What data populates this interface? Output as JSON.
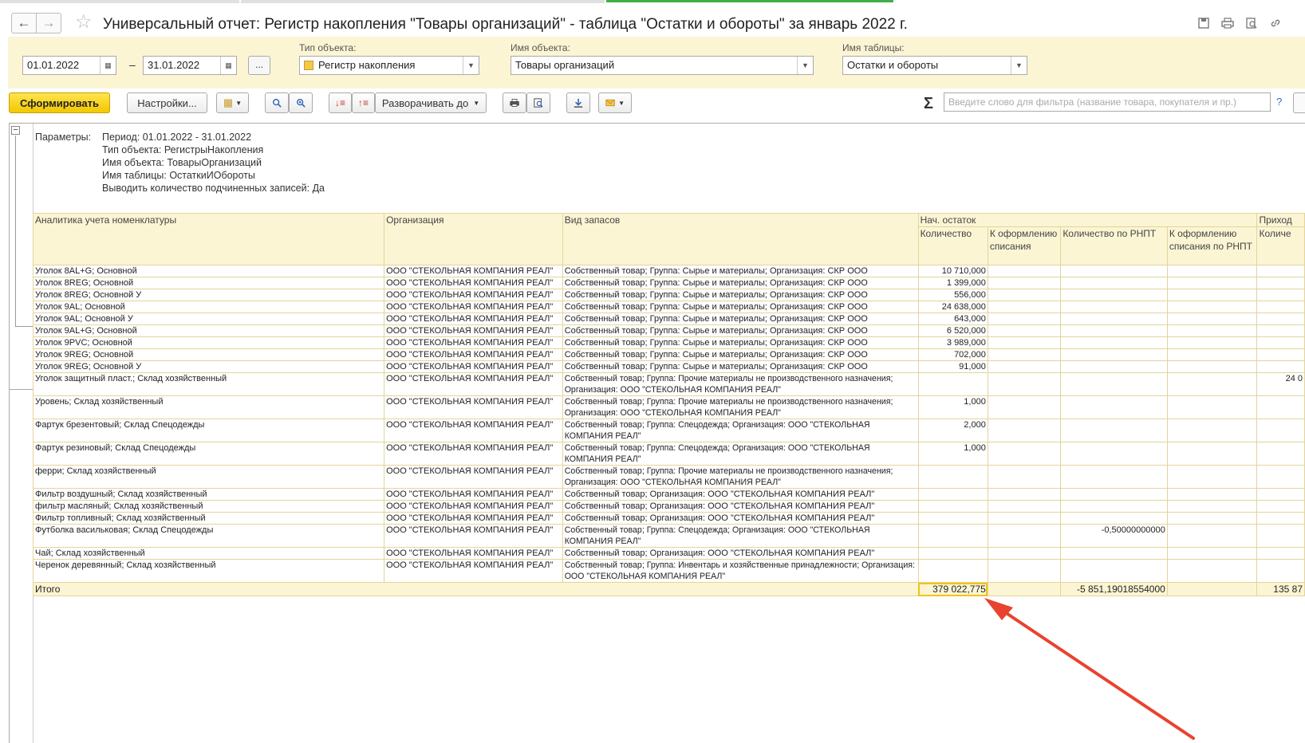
{
  "window": {
    "title": "Универсальный отчет: Регистр накопления \"Товары организаций\" - таблица \"Остатки и обороты\" за январь 2022 г."
  },
  "params": {
    "date_from": "01.01.2022",
    "date_to": "31.01.2022",
    "dash": "–",
    "dots": "...",
    "object_type_label": "Тип объекта:",
    "object_type_value": "Регистр накопления",
    "object_name_label": "Имя объекта:",
    "object_name_value": "Товары организаций",
    "table_name_label": "Имя таблицы:",
    "table_name_value": "Остатки и обороты"
  },
  "toolbar": {
    "generate": "Сформировать",
    "settings": "Настройки...",
    "expand_to": "Разворачивать до",
    "search_placeholder": "Введите слово для фильтра (название товара, покупателя и пр.)",
    "help": "?",
    "sigma": "Σ"
  },
  "report_params": {
    "label": "Параметры:",
    "lines": [
      "Период: 01.01.2022 - 31.01.2022",
      "Тип объекта: РегистрыНакопления",
      "Имя объекта: ТоварыОрганизаций",
      "Имя таблицы: ОстаткиИОбороты",
      "Выводить количество подчиненных записей: Да"
    ]
  },
  "table": {
    "headers": {
      "analytics": "Аналитика учета номенклатуры",
      "org": "Организация",
      "stock_type": "Вид запасов",
      "opening": "Нач. остаток",
      "qty": "Количество",
      "to_writeoff": "К оформлению списания",
      "qty_rnpt": "Количество по РНПТ",
      "to_writeoff_rnpt": "К оформлению списания по РНПТ",
      "income": "Приход",
      "income_qty": "Количе"
    },
    "rows": [
      {
        "a": "Уголок 8AL+G; Основной",
        "o": "ООО \"СТЕКОЛЬНАЯ КОМПАНИЯ РЕАЛ\"",
        "v": "Собственный товар; Группа: Сырье и материалы; Организация: СКР ООО",
        "q": "10 710,000",
        "w": "",
        "r": "",
        "rw": "",
        "i": ""
      },
      {
        "a": "Уголок 8REG; Основной",
        "o": "ООО \"СТЕКОЛЬНАЯ КОМПАНИЯ РЕАЛ\"",
        "v": "Собственный товар; Группа: Сырье и материалы; Организация: СКР ООО",
        "q": "1 399,000",
        "w": "",
        "r": "",
        "rw": "",
        "i": ""
      },
      {
        "a": "Уголок 8REG; Основной У",
        "o": "ООО \"СТЕКОЛЬНАЯ КОМПАНИЯ РЕАЛ\"",
        "v": "Собственный товар; Группа: Сырье и материалы; Организация: СКР ООО",
        "q": "556,000",
        "w": "",
        "r": "",
        "rw": "",
        "i": ""
      },
      {
        "a": "Уголок 9AL; Основной",
        "o": "ООО \"СТЕКОЛЬНАЯ КОМПАНИЯ РЕАЛ\"",
        "v": "Собственный товар; Группа: Сырье и материалы; Организация: СКР ООО",
        "q": "24 638,000",
        "w": "",
        "r": "",
        "rw": "",
        "i": ""
      },
      {
        "a": "Уголок 9AL; Основной У",
        "o": "ООО \"СТЕКОЛЬНАЯ КОМПАНИЯ РЕАЛ\"",
        "v": "Собственный товар; Группа: Сырье и материалы; Организация: СКР ООО",
        "q": "643,000",
        "w": "",
        "r": "",
        "rw": "",
        "i": ""
      },
      {
        "a": "Уголок 9AL+G; Основной",
        "o": "ООО \"СТЕКОЛЬНАЯ КОМПАНИЯ РЕАЛ\"",
        "v": "Собственный товар; Группа: Сырье и материалы; Организация: СКР ООО",
        "q": "6 520,000",
        "w": "",
        "r": "",
        "rw": "",
        "i": ""
      },
      {
        "a": "Уголок 9PVC; Основной",
        "o": "ООО \"СТЕКОЛЬНАЯ КОМПАНИЯ РЕАЛ\"",
        "v": "Собственный товар; Группа: Сырье и материалы; Организация: СКР ООО",
        "q": "3 989,000",
        "w": "",
        "r": "",
        "rw": "",
        "i": ""
      },
      {
        "a": "Уголок 9REG; Основной",
        "o": "ООО \"СТЕКОЛЬНАЯ КОМПАНИЯ РЕАЛ\"",
        "v": "Собственный товар; Группа: Сырье и материалы; Организация: СКР ООО",
        "q": "702,000",
        "w": "",
        "r": "",
        "rw": "",
        "i": ""
      },
      {
        "a": "Уголок 9REG; Основной У",
        "o": "ООО \"СТЕКОЛЬНАЯ КОМПАНИЯ РЕАЛ\"",
        "v": "Собственный товар; Группа: Сырье и материалы; Организация: СКР ООО",
        "q": "91,000",
        "w": "",
        "r": "",
        "rw": "",
        "i": ""
      },
      {
        "a": "Уголок защитный пласт.; Склад хозяйственный",
        "o": "ООО \"СТЕКОЛЬНАЯ КОМПАНИЯ РЕАЛ\"",
        "v": "Собственный товар; Группа: Прочие материалы не производственного назначения; Организация: ООО \"СТЕКОЛЬНАЯ КОМПАНИЯ РЕАЛ\"",
        "q": "",
        "w": "",
        "r": "",
        "rw": "",
        "i": "24 0",
        "tall": true
      },
      {
        "a": "Уровень; Склад хозяйственный",
        "o": "ООО \"СТЕКОЛЬНАЯ КОМПАНИЯ РЕАЛ\"",
        "v": "Собственный товар; Группа: Прочие материалы не производственного назначения; Организация: ООО \"СТЕКОЛЬНАЯ КОМПАНИЯ РЕАЛ\"",
        "q": "1,000",
        "w": "",
        "r": "",
        "rw": "",
        "i": "",
        "tall": true
      },
      {
        "a": "Фартук брезентовый; Склад Спецодежды",
        "o": "ООО \"СТЕКОЛЬНАЯ КОМПАНИЯ РЕАЛ\"",
        "v": "Собственный товар; Группа: Спецодежда; Организация: ООО \"СТЕКОЛЬНАЯ КОМПАНИЯ РЕАЛ\"",
        "q": "2,000",
        "w": "",
        "r": "",
        "rw": "",
        "i": "",
        "tall": true
      },
      {
        "a": "Фартук резиновый; Склад Спецодежды",
        "o": "ООО \"СТЕКОЛЬНАЯ КОМПАНИЯ РЕАЛ\"",
        "v": "Собственный товар; Группа: Спецодежда; Организация: ООО \"СТЕКОЛЬНАЯ КОМПАНИЯ РЕАЛ\"",
        "q": "1,000",
        "w": "",
        "r": "",
        "rw": "",
        "i": "",
        "tall": true
      },
      {
        "a": "ферри; Склад хозяйственный",
        "o": "ООО \"СТЕКОЛЬНАЯ КОМПАНИЯ РЕАЛ\"",
        "v": "Собственный товар; Группа: Прочие материалы не производственного назначения; Организация: ООО \"СТЕКОЛЬНАЯ КОМПАНИЯ РЕАЛ\"",
        "q": "",
        "w": "",
        "r": "",
        "rw": "",
        "i": "",
        "tall": true
      },
      {
        "a": "Фильтр воздушный; Склад хозяйственный",
        "o": "ООО \"СТЕКОЛЬНАЯ КОМПАНИЯ РЕАЛ\"",
        "v": "Собственный товар; Организация: ООО \"СТЕКОЛЬНАЯ КОМПАНИЯ РЕАЛ\"",
        "q": "",
        "w": "",
        "r": "",
        "rw": "",
        "i": ""
      },
      {
        "a": "фильтр масляный; Склад хозяйственный",
        "o": "ООО \"СТЕКОЛЬНАЯ КОМПАНИЯ РЕАЛ\"",
        "v": "Собственный товар; Организация: ООО \"СТЕКОЛЬНАЯ КОМПАНИЯ РЕАЛ\"",
        "q": "",
        "w": "",
        "r": "",
        "rw": "",
        "i": ""
      },
      {
        "a": "Фильтр топливный; Склад хозяйственный",
        "o": "ООО \"СТЕКОЛЬНАЯ КОМПАНИЯ РЕАЛ\"",
        "v": "Собственный товар; Организация: ООО \"СТЕКОЛЬНАЯ КОМПАНИЯ РЕАЛ\"",
        "q": "",
        "w": "",
        "r": "",
        "rw": "",
        "i": ""
      },
      {
        "a": "Футболка васильковая; Склад Спецодежды",
        "o": "ООО \"СТЕКОЛЬНАЯ КОМПАНИЯ РЕАЛ\"",
        "v": "Собственный товар; Группа: Спецодежда; Организация: ООО \"СТЕКОЛЬНАЯ КОМПАНИЯ РЕАЛ\"",
        "q": "",
        "w": "",
        "r": "-0,50000000000",
        "rw": "",
        "i": "",
        "tall": true
      },
      {
        "a": "Чай; Склад хозяйственный",
        "o": "ООО \"СТЕКОЛЬНАЯ КОМПАНИЯ РЕАЛ\"",
        "v": "Собственный товар; Организация: ООО \"СТЕКОЛЬНАЯ КОМПАНИЯ РЕАЛ\"",
        "q": "",
        "w": "",
        "r": "",
        "rw": "",
        "i": ""
      },
      {
        "a": "Черенок деревянный; Склад хозяйственный",
        "o": "ООО \"СТЕКОЛЬНАЯ КОМПАНИЯ РЕАЛ\"",
        "v": "Собственный товар; Группа: Инвентарь и хозяйственные принадлежности; Организация: ООО \"СТЕКОЛЬНАЯ КОМПАНИЯ РЕАЛ\"",
        "q": "",
        "w": "",
        "r": "",
        "rw": "",
        "i": "",
        "tall": true
      }
    ],
    "total": {
      "label": "Итого",
      "qty": "379 022,775",
      "qty_rnpt": "-5 851,19018554000",
      "income": "135 87"
    }
  },
  "colors": {
    "accent_yellow": "#f3c800",
    "header_bg": "#fbf5d4",
    "arrow": "#e8432f"
  }
}
